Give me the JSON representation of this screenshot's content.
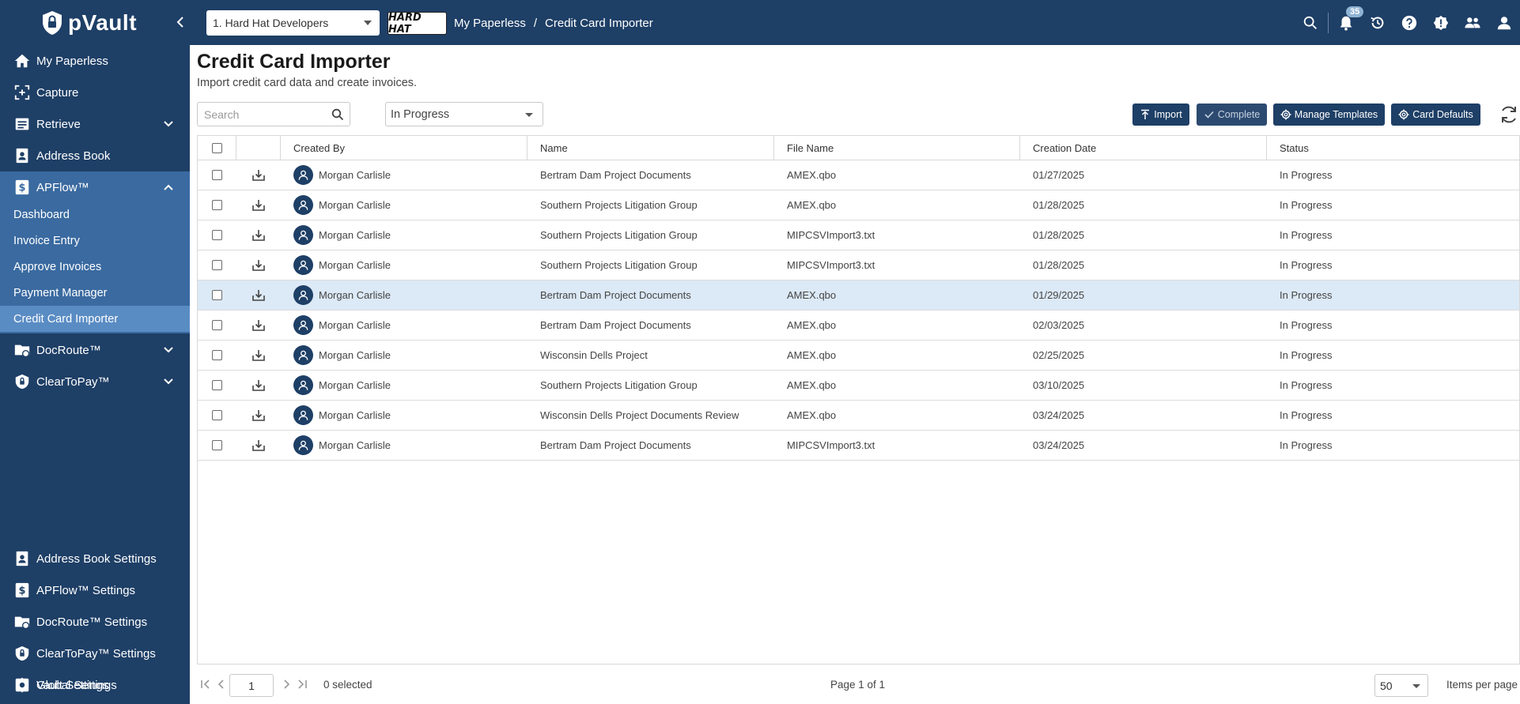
{
  "app": {
    "name": "pVault",
    "org_select": "1. Hard Hat Developers",
    "brand_logo_text": "HARD HAT",
    "notification_count": "35"
  },
  "breadcrumb": [
    "My Paperless",
    "/",
    "Credit Card Importer"
  ],
  "sidebar": {
    "items": [
      {
        "label": "My Paperless",
        "icon": "home-icon"
      },
      {
        "label": "Capture",
        "icon": "capture-icon"
      },
      {
        "label": "Retrieve",
        "icon": "retrieve-icon"
      },
      {
        "label": "Address Book",
        "icon": "address-book-icon"
      },
      {
        "label": "APFlow™",
        "icon": "dollar-icon"
      },
      {
        "label": "DocRoute™",
        "icon": "folder-route-icon"
      },
      {
        "label": "ClearToPay™",
        "icon": "shield-lock-icon"
      }
    ],
    "apflow_sub": [
      "Dashboard",
      "Invoice Entry",
      "Approve Invoices",
      "Payment Manager",
      "Credit Card Importer"
    ],
    "settings": [
      {
        "label": "Address Book Settings",
        "icon": "address-book-icon"
      },
      {
        "label": "APFlow™ Settings",
        "icon": "dollar-icon"
      },
      {
        "label": "DocRoute™ Settings",
        "icon": "folder-route-icon"
      },
      {
        "label": "ClearToPay™ Settings",
        "icon": "shield-lock-icon"
      },
      {
        "label": "Vault Settings",
        "icon": "vault-icon"
      },
      {
        "label": "Global Settings",
        "icon": "gear-icon"
      }
    ]
  },
  "page": {
    "title": "Credit Card Importer",
    "subtitle": "Import credit card data and create invoices.",
    "search_placeholder": "Search",
    "status_filter": "In Progress"
  },
  "toolbar": {
    "import": "Import",
    "complete": "Complete",
    "manage_templates": "Manage Templates",
    "card_defaults": "Card Defaults"
  },
  "table": {
    "headers": [
      "Created By",
      "Name",
      "File Name",
      "Creation Date",
      "Status"
    ],
    "rows": [
      {
        "created_by": "Morgan Carlisle",
        "name": "Bertram Dam Project Documents",
        "file": "AMEX.qbo",
        "date": "01/27/2025",
        "status": "In Progress"
      },
      {
        "created_by": "Morgan Carlisle",
        "name": "Southern Projects Litigation Group",
        "file": "AMEX.qbo",
        "date": "01/28/2025",
        "status": "In Progress"
      },
      {
        "created_by": "Morgan Carlisle",
        "name": "Southern Projects Litigation Group",
        "file": "MIPCSVImport3.txt",
        "date": "01/28/2025",
        "status": "In Progress"
      },
      {
        "created_by": "Morgan Carlisle",
        "name": "Southern Projects Litigation Group",
        "file": "MIPCSVImport3.txt",
        "date": "01/28/2025",
        "status": "In Progress"
      },
      {
        "created_by": "Morgan Carlisle",
        "name": "Bertram Dam Project Documents",
        "file": "AMEX.qbo",
        "date": "01/29/2025",
        "status": "In Progress"
      },
      {
        "created_by": "Morgan Carlisle",
        "name": "Bertram Dam Project Documents",
        "file": "AMEX.qbo",
        "date": "02/03/2025",
        "status": "In Progress"
      },
      {
        "created_by": "Morgan Carlisle",
        "name": "Wisconsin Dells Project",
        "file": "AMEX.qbo",
        "date": "02/25/2025",
        "status": "In Progress"
      },
      {
        "created_by": "Morgan Carlisle",
        "name": "Southern Projects Litigation Group",
        "file": "AMEX.qbo",
        "date": "03/10/2025",
        "status": "In Progress"
      },
      {
        "created_by": "Morgan Carlisle",
        "name": "Wisconsin Dells Project Documents Review",
        "file": "AMEX.qbo",
        "date": "03/24/2025",
        "status": "In Progress"
      },
      {
        "created_by": "Morgan Carlisle",
        "name": "Bertram Dam Project Documents",
        "file": "MIPCSVImport3.txt",
        "date": "03/24/2025",
        "status": "In Progress"
      }
    ],
    "selected_row_index": 4
  },
  "footer": {
    "page_input": "1",
    "selected_count": "0 selected",
    "page_of": "Page 1 of 1",
    "per_page": "50",
    "per_page_label": "Items per page"
  },
  "colors": {
    "nav_bg": "#1e3f66",
    "submenu_bg": "#3a6aa0",
    "active_bg": "#5a8cc4",
    "selected_row": "#dce9f6"
  }
}
